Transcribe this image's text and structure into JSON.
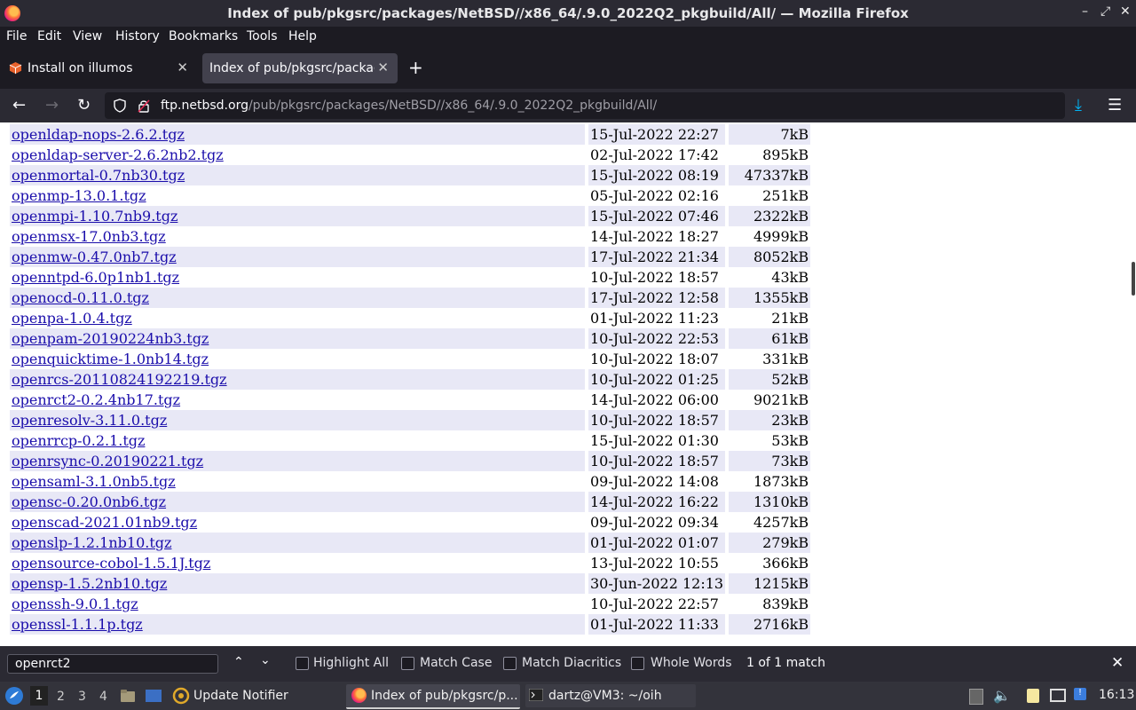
{
  "window": {
    "title": "Index of pub/pkgsrc/packages/NetBSD//x86_64/.9.0_2022Q2_pkgbuild/All/ — Mozilla Firefox"
  },
  "menu": [
    "File",
    "Edit",
    "View",
    "History",
    "Bookmarks",
    "Tools",
    "Help"
  ],
  "tabs": [
    {
      "label": "Install on illumos",
      "active": false
    },
    {
      "label": "Index of pub/pkgsrc/packag",
      "active": true
    }
  ],
  "urlbar": {
    "host": "ftp.netbsd.org",
    "path": "/pub/pkgsrc/packages/NetBSD//x86_64/.9.0_2022Q2_pkgbuild/All/"
  },
  "files": [
    {
      "name": "openldap-nops-2.6.2.tgz",
      "date": "15-Jul-2022 22:27",
      "size": "7kB"
    },
    {
      "name": "openldap-server-2.6.2nb2.tgz",
      "date": "02-Jul-2022 17:42",
      "size": "895kB"
    },
    {
      "name": "openmortal-0.7nb30.tgz",
      "date": "15-Jul-2022 08:19",
      "size": "47337kB"
    },
    {
      "name": "openmp-13.0.1.tgz",
      "date": "05-Jul-2022 02:16",
      "size": "251kB"
    },
    {
      "name": "openmpi-1.10.7nb9.tgz",
      "date": "15-Jul-2022 07:46",
      "size": "2322kB"
    },
    {
      "name": "openmsx-17.0nb3.tgz",
      "date": "14-Jul-2022 18:27",
      "size": "4999kB"
    },
    {
      "name": "openmw-0.47.0nb7.tgz",
      "date": "17-Jul-2022 21:34",
      "size": "8052kB"
    },
    {
      "name": "openntpd-6.0p1nb1.tgz",
      "date": "10-Jul-2022 18:57",
      "size": "43kB"
    },
    {
      "name": "openocd-0.11.0.tgz",
      "date": "17-Jul-2022 12:58",
      "size": "1355kB"
    },
    {
      "name": "openpa-1.0.4.tgz",
      "date": "01-Jul-2022 11:23",
      "size": "21kB"
    },
    {
      "name": "openpam-20190224nb3.tgz",
      "date": "10-Jul-2022 22:53",
      "size": "61kB"
    },
    {
      "name": "openquicktime-1.0nb14.tgz",
      "date": "10-Jul-2022 18:07",
      "size": "331kB"
    },
    {
      "name": "openrcs-20110824192219.tgz",
      "date": "10-Jul-2022 01:25",
      "size": "52kB"
    },
    {
      "name": "openrct2-0.2.4nb17.tgz",
      "date": "14-Jul-2022 06:00",
      "size": "9021kB"
    },
    {
      "name": "openresolv-3.11.0.tgz",
      "date": "10-Jul-2022 18:57",
      "size": "23kB"
    },
    {
      "name": "openrrcp-0.2.1.tgz",
      "date": "15-Jul-2022 01:30",
      "size": "53kB"
    },
    {
      "name": "openrsync-0.20190221.tgz",
      "date": "10-Jul-2022 18:57",
      "size": "73kB"
    },
    {
      "name": "opensaml-3.1.0nb5.tgz",
      "date": "09-Jul-2022 14:08",
      "size": "1873kB"
    },
    {
      "name": "opensc-0.20.0nb6.tgz",
      "date": "14-Jul-2022 16:22",
      "size": "1310kB"
    },
    {
      "name": "openscad-2021.01nb9.tgz",
      "date": "09-Jul-2022 09:34",
      "size": "4257kB"
    },
    {
      "name": "openslp-1.2.1nb10.tgz",
      "date": "01-Jul-2022 01:07",
      "size": "279kB"
    },
    {
      "name": "opensource-cobol-1.5.1J.tgz",
      "date": "13-Jul-2022 10:55",
      "size": "366kB"
    },
    {
      "name": "opensp-1.5.2nb10.tgz",
      "date": "30-Jun-2022 12:13",
      "size": "1215kB"
    },
    {
      "name": "openssh-9.0.1.tgz",
      "date": "10-Jul-2022 22:57",
      "size": "839kB"
    },
    {
      "name": "openssl-1.1.1p.tgz",
      "date": "01-Jul-2022 11:33",
      "size": "2716kB"
    }
  ],
  "findbar": {
    "query": "openrct2",
    "highlight_all": "Highlight All",
    "match_case": "Match Case",
    "match_diacritics": "Match Diacritics",
    "whole_words": "Whole Words",
    "result": "1 of 1 match"
  },
  "taskbar": {
    "workspaces": [
      "1",
      "2",
      "3",
      "4"
    ],
    "tasks": [
      {
        "label": "Update Notifier"
      },
      {
        "label": "Index of pub/pkgsrc/p..."
      },
      {
        "label": "dartz@VM3: ~/oih"
      }
    ],
    "clock": "16:13"
  },
  "colors": {
    "link": "#1a0dab",
    "row_alt": "#e8e8f6",
    "chrome_dark": "#1c1b22",
    "chrome_mid": "#2b2a33"
  }
}
